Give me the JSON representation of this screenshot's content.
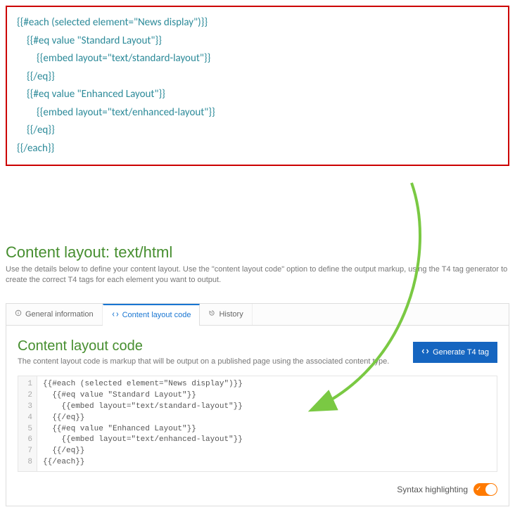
{
  "top_code": {
    "l1": "{{#each (selected element=\"News display\")}}",
    "l2": "{{#eq value \"Standard Layout\"}}",
    "l3": "{{embed layout=\"text/standard-layout\"}}",
    "l4": "{{/eq}}",
    "l5": "{{#eq value \"Enhanced Layout\"}}",
    "l6": "{{embed layout=\"text/enhanced-layout\"}}",
    "l7": "{{/eq}}",
    "l8": "{{/each}}"
  },
  "page": {
    "title": "Content layout: text/html",
    "desc": "Use the details below to define your content layout. Use the \"content layout code\" option to define the output markup, using the T4 tag generator to create the correct T4 tags for each element you want to output."
  },
  "tabs": {
    "general": "General information",
    "code": "Content layout code",
    "history": "History"
  },
  "sub": {
    "title": "Content layout code",
    "desc": "The content layout code is markup that will be output on a published page using the associated content type."
  },
  "button": {
    "generate": "Generate T4 tag"
  },
  "editor": {
    "lines": [
      "{{#each (selected element=\"News display\")}}",
      "  {{#eq value \"Standard Layout\"}}",
      "    {{embed layout=\"text/standard-layout\"}}",
      "  {{/eq}}",
      "  {{#eq value \"Enhanced Layout\"}}",
      "    {{embed layout=\"text/enhanced-layout\"}}",
      "  {{/eq}}",
      "{{/each}}"
    ]
  },
  "syntax": {
    "label": "Syntax highlighting",
    "on": true
  }
}
